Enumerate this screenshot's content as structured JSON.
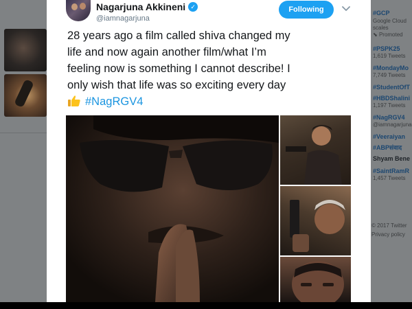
{
  "tweet": {
    "author_name": "Nagarjuna Akkineni",
    "handle": "@iamnagarjuna",
    "follow_label": "Following",
    "text_line1": "28 years ago a film called shiva changed my",
    "text_line2": "life and now again another film/what I’m",
    "text_line3": "feeling now is something I cannot describe! I",
    "text_line4": "only wish that life was so exciting every day",
    "hashtag": "#NagRGV4"
  },
  "trends": [
    {
      "tag": "#GCP",
      "sub": "Google Cloud"
    },
    {
      "tag": "",
      "sub": "scales"
    },
    {
      "tag": "",
      "sub": "",
      "promo": "Promoted"
    },
    {
      "tag": "#PSPK25",
      "sub": "1,619 Tweets"
    },
    {
      "tag": "#MondayMo",
      "sub": "7,749 Tweets"
    },
    {
      "tag": "#StudentOfT",
      "sub": ""
    },
    {
      "tag": "#HBDShalini",
      "sub": "1,197 Tweets"
    },
    {
      "tag": "#NagRGV4",
      "sub": "@iamnagarjuna"
    },
    {
      "tag": "#Veeraiyan",
      "sub": ""
    },
    {
      "tag": "#ABPसंवाद",
      "sub": ""
    },
    {
      "tag": "Shyam Bene",
      "sub": ""
    },
    {
      "tag": "#SaintRamR",
      "sub": "1,457 Tweets"
    }
  ],
  "footer": {
    "line1": "© 2017 Twitter",
    "line2": "Privacy policy"
  },
  "icons": {
    "verified": "verified-badge-icon",
    "chevron": "chevron-down-icon",
    "thumbs": "thumbs-up-emoji-icon"
  },
  "colors": {
    "accent": "#1da1f2",
    "hashtag": "#1b95e0"
  }
}
